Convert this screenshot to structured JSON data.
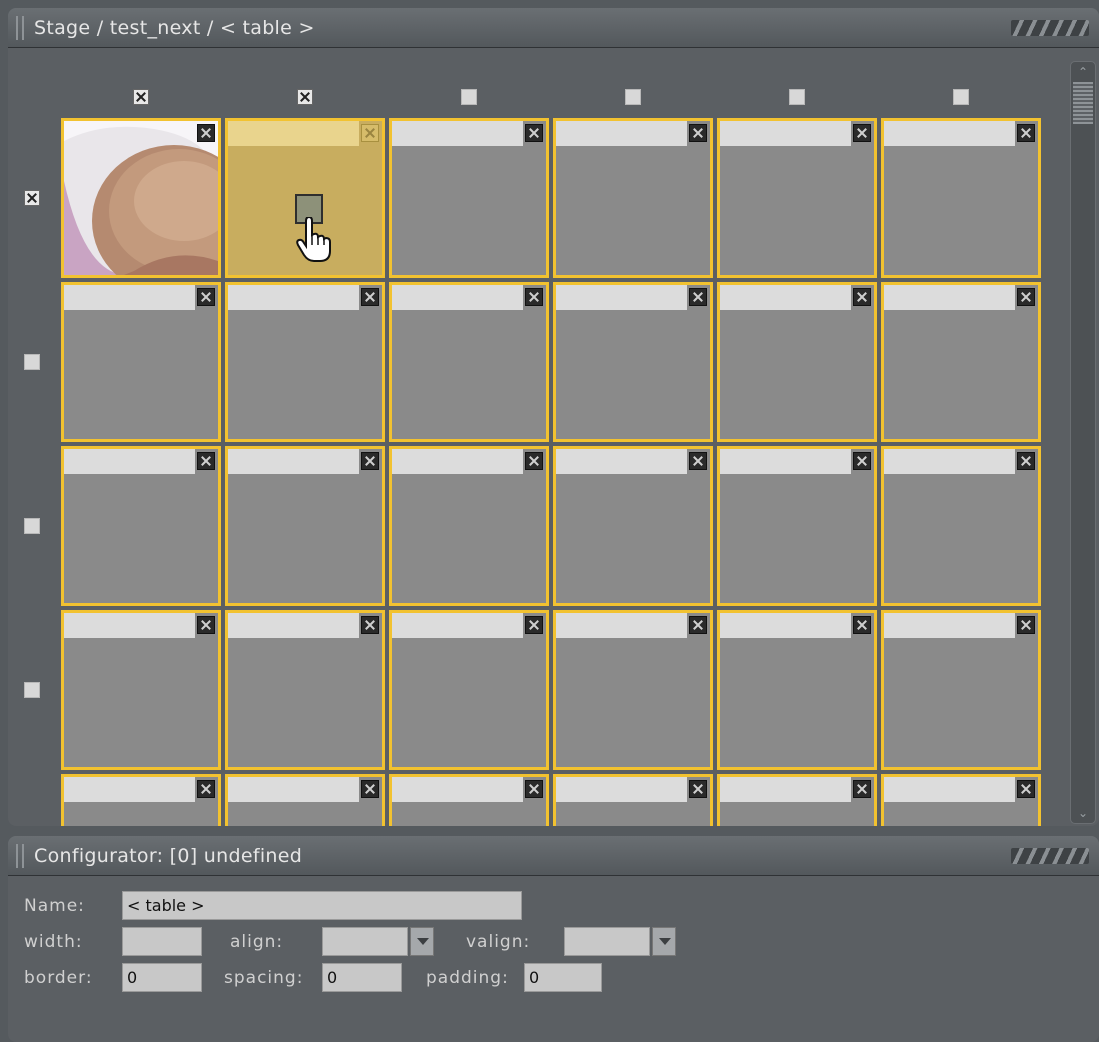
{
  "stage": {
    "title": "Stage / test_next / < table >",
    "columns": [
      {
        "checked": true
      },
      {
        "checked": true
      },
      {
        "checked": false
      },
      {
        "checked": false
      },
      {
        "checked": false
      },
      {
        "checked": false
      }
    ],
    "rows": [
      {
        "checked": true
      },
      {
        "checked": false
      },
      {
        "checked": false
      },
      {
        "checked": false
      },
      {
        "checked": false
      }
    ],
    "selected_cell": {
      "row": 0,
      "col": 1
    },
    "photo_cell": {
      "row": 0,
      "col": 0
    },
    "colors": {
      "cell_border": "#f2c230",
      "cell_bg": "#8a8a8a",
      "selected_bg": "#c8ad5f",
      "panel_bg": "#5b5f63"
    }
  },
  "configurator": {
    "title": "Configurator: [0] undefined",
    "name_label": "Name:",
    "name_value": "< table >",
    "width_label": "width:",
    "width_value": "",
    "align_label": "align:",
    "align_value": "",
    "valign_label": "valign:",
    "valign_value": "",
    "border_label": "border:",
    "border_value": "0",
    "spacing_label": "spacing:",
    "spacing_value": "0",
    "padding_label": "padding:",
    "padding_value": "0"
  }
}
